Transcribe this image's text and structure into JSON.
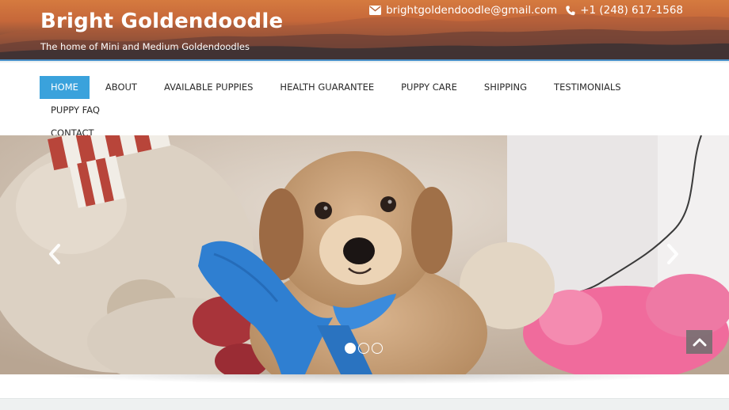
{
  "site": {
    "title": "Bright Goldendoodle",
    "tagline": "The home of Mini and Medium Goldendoodles"
  },
  "contact": {
    "email": "brightgoldendoodle@gmail.com",
    "email_icon": "envelope-icon",
    "phone": "+1 (248) 617-1568",
    "phone_icon": "phone-icon"
  },
  "nav": {
    "items": [
      {
        "label": "HOME",
        "active": true
      },
      {
        "label": "ABOUT"
      },
      {
        "label": "AVAILABLE PUPPIES"
      },
      {
        "label": "HEALTH GUARANTEE"
      },
      {
        "label": "PUPPY CARE"
      },
      {
        "label": "SHIPPING"
      },
      {
        "label": "TESTIMONIALS"
      },
      {
        "label": "PUPPY FAQ"
      },
      {
        "label": "CONTACT"
      }
    ]
  },
  "slider": {
    "prev_icon": "chevron-left-icon",
    "next_icon": "chevron-right-icon",
    "slide_count": 3,
    "active_slide": 1,
    "back_to_top_icon": "chevron-up-icon"
  },
  "colors": {
    "accent": "#3aa2dc",
    "header_border": "#4a90c8",
    "menu_text": "#2a2a2a"
  }
}
